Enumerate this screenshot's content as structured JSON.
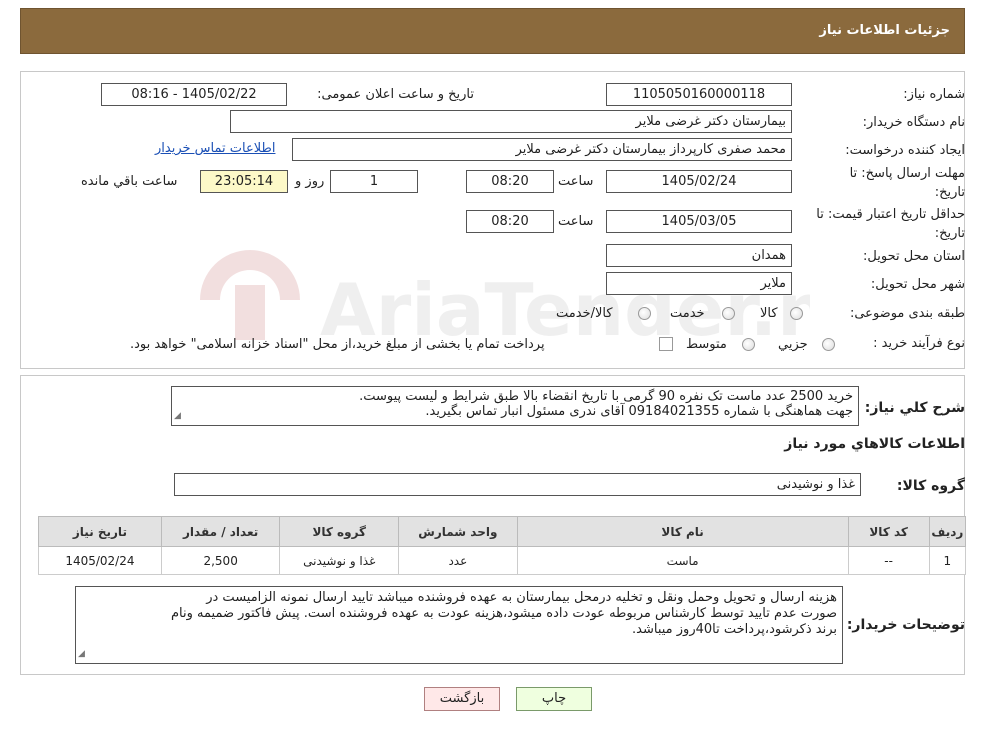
{
  "header": {
    "title": "جزئیات اطلاعات نیاز"
  },
  "fields": {
    "need_number_label": "شماره نیاز:",
    "need_number": "1105050160000118",
    "announce_label": "تاریخ و ساعت اعلان عمومی:",
    "announce_value": "1405/02/22 - 08:16",
    "buyer_org_label": "نام دستگاه خریدار:",
    "buyer_org": "بیمارستان دکتر غرضی ملایر",
    "creator_label": "ایجاد کننده درخواست:",
    "creator": "محمد صفری کارپرداز بیمارستان دکتر غرضی ملایر",
    "contact_link": "اطلاعات تماس خریدار",
    "deadline_label": "مهلت ارسال پاسخ: تا تاریخ:",
    "deadline_date": "1405/02/24",
    "time_label": "ساعت",
    "deadline_time": "08:20",
    "days_value": "1",
    "days_label": "روز و",
    "remaining_time": "23:05:14",
    "remaining_label": "ساعت باقي مانده",
    "validity_label": "حداقل تاریخ اعتبار قیمت: تا تاریخ:",
    "validity_date": "1405/03/05",
    "validity_time": "08:20",
    "province_label": "استان محل تحویل:",
    "province": "همدان",
    "city_label": "شهر محل تحویل:",
    "city": "ملایر",
    "category_label": "طبقه بندی موضوعی:",
    "category_options": [
      "کالا",
      "خدمت",
      "کالا/خدمت"
    ],
    "process_label": "نوع فرآیند خرید :",
    "process_options": [
      "جزیي",
      "متوسط"
    ],
    "process_note": "پرداخت تمام یا بخشی از مبلغ خرید،از محل \"اسناد خزانه اسلامی\" خواهد بود."
  },
  "summary": {
    "label": "شرح کلي نياز:",
    "line1": "خرید 2500 عدد ماست تک نفره 90 گرمی با تاریخ انقضاء بالا طبق شرایط و لیست پیوست.",
    "line2": "جهت هماهنگی با شماره 09184021355 آقای ندری مسئول انبار تماس بگیرید."
  },
  "goods_section": {
    "title": "اطلاعات کالاهاي مورد نياز",
    "group_label": "گروه کالا:",
    "group_value": "غذا و نوشیدنی"
  },
  "table": {
    "headers": [
      "رديف",
      "کد کالا",
      "نام کالا",
      "واحد شمارش",
      "گروه کالا",
      "تعداد / مقدار",
      "تاریخ نیاز"
    ],
    "rows": [
      [
        "1",
        "--",
        "ماست",
        "عدد",
        "غذا و نوشیدنی",
        "2,500",
        "1405/02/24"
      ]
    ]
  },
  "buyer_notes": {
    "label": "توضیحات خریدار:",
    "line1": "هزینه ارسال و تحویل وحمل ونقل و تخلیه درمحل بیمارستان به عهده فروشنده میباشد تایید ارسال نمونه الزامیست در",
    "line2": "صورت عدم تایید توسط کارشناس مربوطه عودت داده میشود،هزینه عودت به عهده فروشنده است. پیش فاکتور ضمیمه ونام",
    "line3": "برند ذکرشود،پرداخت تا40روز میباشد."
  },
  "buttons": {
    "print": "چاپ",
    "back": "بازگشت"
  },
  "watermark": {
    "text": "AriaTender.neT"
  },
  "colors": {
    "header_bg": "#8b6a3d",
    "link": "#1a4fb5",
    "print_bg": "#efffdf",
    "back_bg": "#ffe8e8"
  }
}
